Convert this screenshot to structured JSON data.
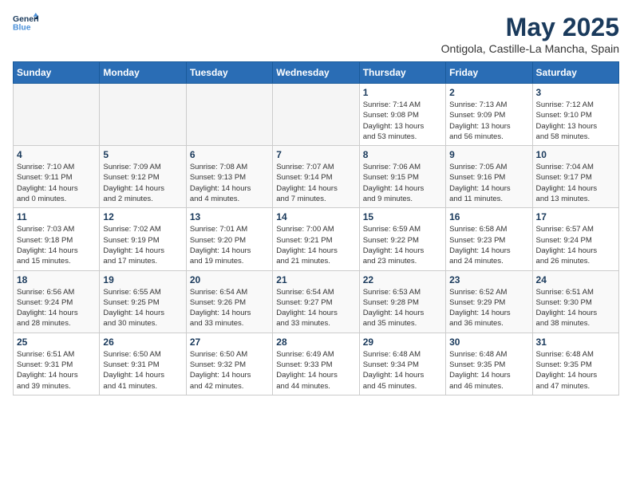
{
  "header": {
    "logo_line1": "General",
    "logo_line2": "Blue",
    "month": "May 2025",
    "location": "Ontigola, Castille-La Mancha, Spain"
  },
  "weekdays": [
    "Sunday",
    "Monday",
    "Tuesday",
    "Wednesday",
    "Thursday",
    "Friday",
    "Saturday"
  ],
  "weeks": [
    [
      {
        "day": "",
        "info": ""
      },
      {
        "day": "",
        "info": ""
      },
      {
        "day": "",
        "info": ""
      },
      {
        "day": "",
        "info": ""
      },
      {
        "day": "1",
        "info": "Sunrise: 7:14 AM\nSunset: 9:08 PM\nDaylight: 13 hours\nand 53 minutes."
      },
      {
        "day": "2",
        "info": "Sunrise: 7:13 AM\nSunset: 9:09 PM\nDaylight: 13 hours\nand 56 minutes."
      },
      {
        "day": "3",
        "info": "Sunrise: 7:12 AM\nSunset: 9:10 PM\nDaylight: 13 hours\nand 58 minutes."
      }
    ],
    [
      {
        "day": "4",
        "info": "Sunrise: 7:10 AM\nSunset: 9:11 PM\nDaylight: 14 hours\nand 0 minutes."
      },
      {
        "day": "5",
        "info": "Sunrise: 7:09 AM\nSunset: 9:12 PM\nDaylight: 14 hours\nand 2 minutes."
      },
      {
        "day": "6",
        "info": "Sunrise: 7:08 AM\nSunset: 9:13 PM\nDaylight: 14 hours\nand 4 minutes."
      },
      {
        "day": "7",
        "info": "Sunrise: 7:07 AM\nSunset: 9:14 PM\nDaylight: 14 hours\nand 7 minutes."
      },
      {
        "day": "8",
        "info": "Sunrise: 7:06 AM\nSunset: 9:15 PM\nDaylight: 14 hours\nand 9 minutes."
      },
      {
        "day": "9",
        "info": "Sunrise: 7:05 AM\nSunset: 9:16 PM\nDaylight: 14 hours\nand 11 minutes."
      },
      {
        "day": "10",
        "info": "Sunrise: 7:04 AM\nSunset: 9:17 PM\nDaylight: 14 hours\nand 13 minutes."
      }
    ],
    [
      {
        "day": "11",
        "info": "Sunrise: 7:03 AM\nSunset: 9:18 PM\nDaylight: 14 hours\nand 15 minutes."
      },
      {
        "day": "12",
        "info": "Sunrise: 7:02 AM\nSunset: 9:19 PM\nDaylight: 14 hours\nand 17 minutes."
      },
      {
        "day": "13",
        "info": "Sunrise: 7:01 AM\nSunset: 9:20 PM\nDaylight: 14 hours\nand 19 minutes."
      },
      {
        "day": "14",
        "info": "Sunrise: 7:00 AM\nSunset: 9:21 PM\nDaylight: 14 hours\nand 21 minutes."
      },
      {
        "day": "15",
        "info": "Sunrise: 6:59 AM\nSunset: 9:22 PM\nDaylight: 14 hours\nand 23 minutes."
      },
      {
        "day": "16",
        "info": "Sunrise: 6:58 AM\nSunset: 9:23 PM\nDaylight: 14 hours\nand 24 minutes."
      },
      {
        "day": "17",
        "info": "Sunrise: 6:57 AM\nSunset: 9:24 PM\nDaylight: 14 hours\nand 26 minutes."
      }
    ],
    [
      {
        "day": "18",
        "info": "Sunrise: 6:56 AM\nSunset: 9:24 PM\nDaylight: 14 hours\nand 28 minutes."
      },
      {
        "day": "19",
        "info": "Sunrise: 6:55 AM\nSunset: 9:25 PM\nDaylight: 14 hours\nand 30 minutes."
      },
      {
        "day": "20",
        "info": "Sunrise: 6:54 AM\nSunset: 9:26 PM\nDaylight: 14 hours\nand 33 minutes."
      },
      {
        "day": "21",
        "info": "Sunrise: 6:54 AM\nSunset: 9:27 PM\nDaylight: 14 hours\nand 33 minutes."
      },
      {
        "day": "22",
        "info": "Sunrise: 6:53 AM\nSunset: 9:28 PM\nDaylight: 14 hours\nand 35 minutes."
      },
      {
        "day": "23",
        "info": "Sunrise: 6:52 AM\nSunset: 9:29 PM\nDaylight: 14 hours\nand 36 minutes."
      },
      {
        "day": "24",
        "info": "Sunrise: 6:51 AM\nSunset: 9:30 PM\nDaylight: 14 hours\nand 38 minutes."
      }
    ],
    [
      {
        "day": "25",
        "info": "Sunrise: 6:51 AM\nSunset: 9:31 PM\nDaylight: 14 hours\nand 39 minutes."
      },
      {
        "day": "26",
        "info": "Sunrise: 6:50 AM\nSunset: 9:31 PM\nDaylight: 14 hours\nand 41 minutes."
      },
      {
        "day": "27",
        "info": "Sunrise: 6:50 AM\nSunset: 9:32 PM\nDaylight: 14 hours\nand 42 minutes."
      },
      {
        "day": "28",
        "info": "Sunrise: 6:49 AM\nSunset: 9:33 PM\nDaylight: 14 hours\nand 44 minutes."
      },
      {
        "day": "29",
        "info": "Sunrise: 6:48 AM\nSunset: 9:34 PM\nDaylight: 14 hours\nand 45 minutes."
      },
      {
        "day": "30",
        "info": "Sunrise: 6:48 AM\nSunset: 9:35 PM\nDaylight: 14 hours\nand 46 minutes."
      },
      {
        "day": "31",
        "info": "Sunrise: 6:48 AM\nSunset: 9:35 PM\nDaylight: 14 hours\nand 47 minutes."
      }
    ]
  ]
}
